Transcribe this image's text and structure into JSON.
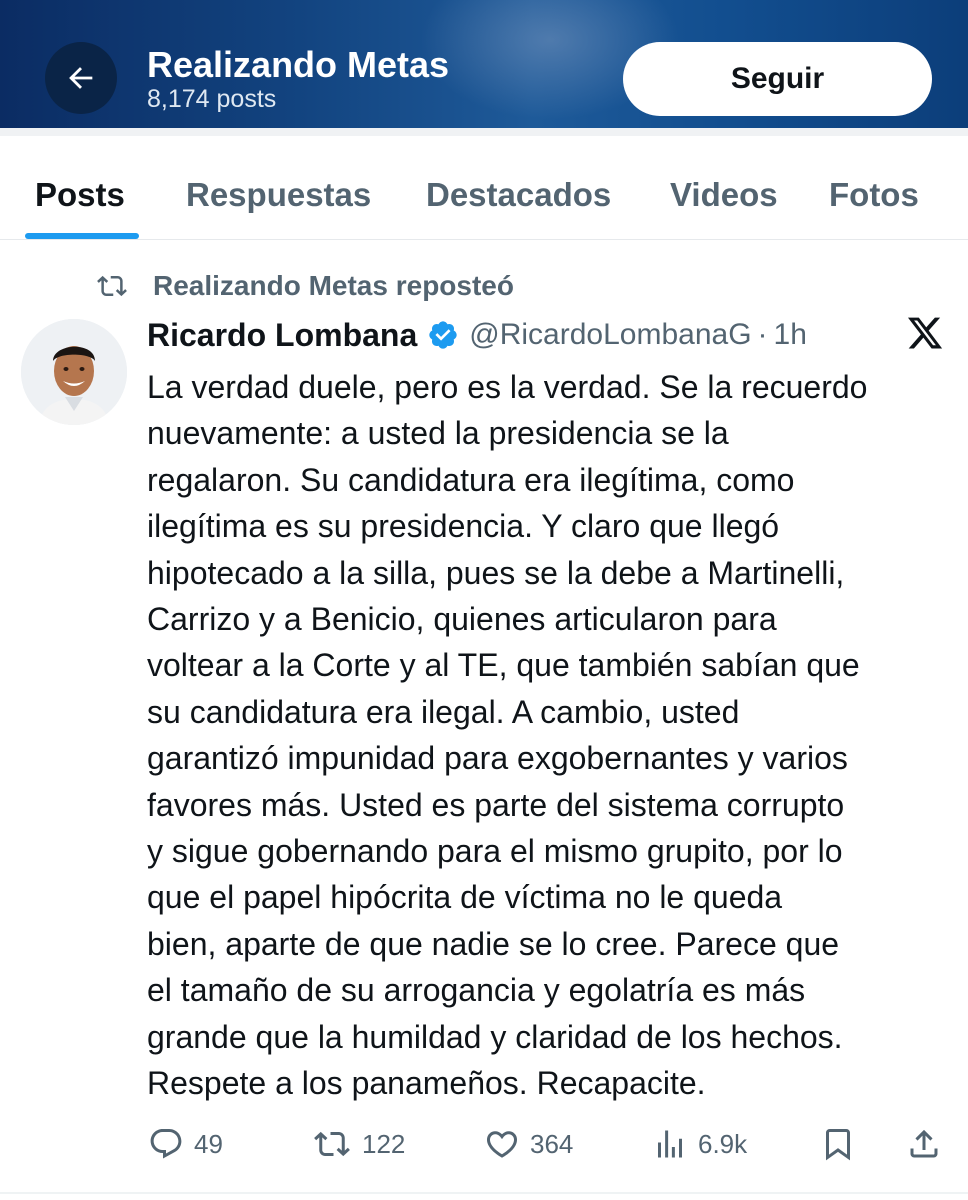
{
  "header": {
    "title": "Realizando Metas",
    "posts_count": "8,174 posts",
    "follow_label": "Seguir"
  },
  "tabs": [
    {
      "label": "Posts",
      "active": true
    },
    {
      "label": "Respuestas",
      "active": false
    },
    {
      "label": "Destacados",
      "active": false
    },
    {
      "label": "Videos",
      "active": false
    },
    {
      "label": "Fotos",
      "active": false
    }
  ],
  "post": {
    "repost_label": "Realizando Metas reposteó",
    "author_name": "Ricardo Lombana",
    "handle": "@RicardoLombanaG",
    "separator": "·",
    "time": "1h",
    "text": "La verdad duele, pero es la verdad. Se la recuerdo\nnuevamente: a usted la presidencia se la\nregalaron. Su candidatura era ilegítima, como\nilegítima es su presidencia. Y claro que llegó\nhipotecado a la silla, pues se la debe a Martinelli,\nCarrizo y a Benicio, quienes articularon para\nvoltear a la Corte y al TE, que también sabían que\nsu candidatura era ilegal. A cambio, usted\ngarantizó impunidad para exgobernantes y varios\nfavores más. Usted es parte del sistema corrupto\ny sigue gobernando para el mismo grupito, por lo\nque el papel hipócrita de víctima no le queda\nbien, aparte de que nadie se lo cree. Parece que\nel tamaño de su arrogancia y egolatría es más\ngrande que la humildad y claridad de los hechos.\nRespete a los panameños. Recapacite.",
    "actions": {
      "replies": "49",
      "reposts": "122",
      "likes": "364",
      "views": "6.9k"
    }
  },
  "colors": {
    "accent": "#1d9bf0",
    "header_bg": "#12437f",
    "muted_text": "#536471",
    "primary_text": "#0f1419"
  },
  "icons": [
    "back-arrow-icon",
    "repost-icon",
    "verified-badge-icon",
    "x-logo-icon",
    "reply-icon",
    "repost-icon",
    "like-icon",
    "views-icon",
    "bookmark-icon",
    "share-icon"
  ]
}
